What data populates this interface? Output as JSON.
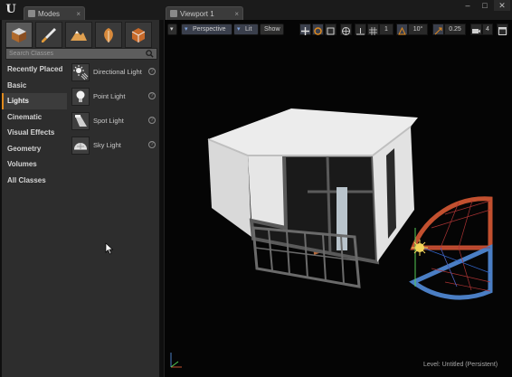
{
  "topbar": {
    "modes_tab": "Modes",
    "viewport_tab": "Viewport 1",
    "minimize": "–",
    "maximize": "□",
    "close": "✕"
  },
  "modes_panel": {
    "search_placeholder": "Search Classes",
    "categories": [
      {
        "label": "Recently Placed",
        "active": false
      },
      {
        "label": "Basic",
        "active": false
      },
      {
        "label": "Lights",
        "active": true
      },
      {
        "label": "Cinematic",
        "active": false
      },
      {
        "label": "Visual Effects",
        "active": false
      },
      {
        "label": "Geometry",
        "active": false
      },
      {
        "label": "Volumes",
        "active": false
      },
      {
        "label": "All Classes",
        "active": false
      }
    ],
    "assets": [
      {
        "label": "Directional Light",
        "icon": "directional-light-icon"
      },
      {
        "label": "Point Light",
        "icon": "point-light-icon"
      },
      {
        "label": "Spot Light",
        "icon": "spot-light-icon"
      },
      {
        "label": "Sky Light",
        "icon": "sky-light-icon"
      }
    ]
  },
  "viewport": {
    "perspective_label": "Perspective",
    "lit_label": "Lit",
    "show_label": "Show",
    "grid_snap": "1",
    "rotation_snap": "10°",
    "scale_snap": "0.25",
    "camera_speed": "4",
    "level_status": "Level:  Untitled (Persistent)"
  },
  "colors": {
    "accent_orange": "#e08a1e",
    "sky_light_red": "#c2502f",
    "sky_light_blue": "#4a7ec4"
  }
}
